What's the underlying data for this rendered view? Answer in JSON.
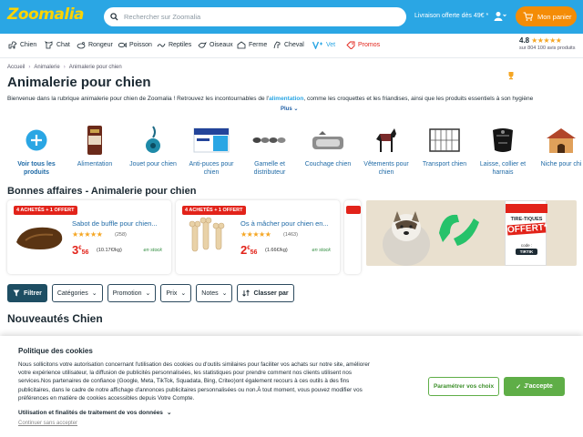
{
  "header": {
    "logo": "Zoomalia",
    "search_placeholder": "Rechercher sur Zoomalia",
    "delivery": "Livraison offerte dès 49€ *",
    "cart_label": "Mon panier"
  },
  "nav": {
    "items": [
      {
        "label": "Chien",
        "icon": "dog-icon"
      },
      {
        "label": "Chat",
        "icon": "cat-icon"
      },
      {
        "label": "Rongeur",
        "icon": "rodent-icon"
      },
      {
        "label": "Poisson",
        "icon": "fish-icon"
      },
      {
        "label": "Reptiles",
        "icon": "reptile-icon"
      },
      {
        "label": "Oiseaux",
        "icon": "bird-icon"
      },
      {
        "label": "Ferme",
        "icon": "farm-icon"
      },
      {
        "label": "Cheval",
        "icon": "horse-icon"
      },
      {
        "label": "Vet",
        "icon": "vet-icon"
      },
      {
        "label": "Promos",
        "icon": "promo-icon"
      }
    ],
    "rating": {
      "score": "4.8",
      "stars": "★★★★★",
      "count": "sur 804 100 avis produits"
    }
  },
  "breadcrumb": [
    "Accueil",
    "Animalerie",
    "Animalerie pour chien"
  ],
  "page": {
    "title": "Animalerie pour chien",
    "intro_before": "Bienvenue dans la rubrique animalerie pour chien de Zoomalia ! Retrouvez les incontournables de l'",
    "intro_link": "alimentation",
    "intro_after": ", comme les croquettes et les friandises, ainsi que les produits essentiels à son hygiène",
    "plus": "Plus"
  },
  "categories": [
    {
      "label": "Voir tous les produits"
    },
    {
      "label": "Alimentation"
    },
    {
      "label": "Jouet pour chien"
    },
    {
      "label": "Anti-puces pour chien"
    },
    {
      "label": "Gamelle et distributeur"
    },
    {
      "label": "Couchage chien"
    },
    {
      "label": "Vêtements pour chien"
    },
    {
      "label": "Transport chien"
    },
    {
      "label": "Laisse, collier et harnais"
    },
    {
      "label": "Niche pour chi"
    }
  ],
  "deals": {
    "title": "Bonnes affaires - Animalerie pour chien",
    "items": [
      {
        "badge": "4 ACHETÉS + 1 OFFERT",
        "name": "Sabot de buffle pour chien...",
        "stars": "★★★★★",
        "reviews": "(258)",
        "price_int": "3",
        "price_dec": "56",
        "currency": "€",
        "unit": "(10.17€/kg)",
        "stock": "en stock"
      },
      {
        "badge": "4 ACHETÉS + 1 OFFERT",
        "name": "Os à mâcher pour chien en...",
        "stars": "★★★★★",
        "reviews": "(1463)",
        "price_int": "2",
        "price_dec": "56",
        "currency": "€",
        "unit": "(1.66€/kg)",
        "stock": "en stock"
      }
    ]
  },
  "ad": {
    "title": "TIRE-TIQUES",
    "offer": "OFFERT*",
    "code_label": "code :",
    "code": "TIRTIK"
  },
  "filters": [
    {
      "label": "Filtrer"
    },
    {
      "label": "Catégories"
    },
    {
      "label": "Promotion"
    },
    {
      "label": "Prix"
    },
    {
      "label": "Notes"
    },
    {
      "label": "Classer par"
    }
  ],
  "new_title": "Nouveautés Chien",
  "cookie": {
    "title": "Politique des cookies",
    "text": "Nous sollicitons votre autorisation concernant l'utilisation des cookies ou d'outils similaires pour faciliter vos achats sur notre site, améliorer votre expérience utilisateur, la diffusion de publicités personnalisées, les statistiques pour prendre comment nos clients utilisent nos services.Nos partenaires de confiance (Google, Meta, TikTok, Squadata, Bing, Criteo)ont également recours à ces outils à des fins publicitaires, dans le cadre de notre affichage d'annonces publicitaires personnalisées ou non.À tout moment, vous pouvez modifier vos préférences en matière de cookies accessibles depuis Votre Compte.",
    "usage": "Utilisation et finalités de traitement de vos données",
    "continue": "Continuer sans accepter",
    "param": "Paramétrer vos choix",
    "accept": "J'accepte"
  },
  "colors": {
    "brand": "#2aa6e4",
    "cart": "#f48c06",
    "price": "#e2231a",
    "accept": "#5fae47"
  }
}
